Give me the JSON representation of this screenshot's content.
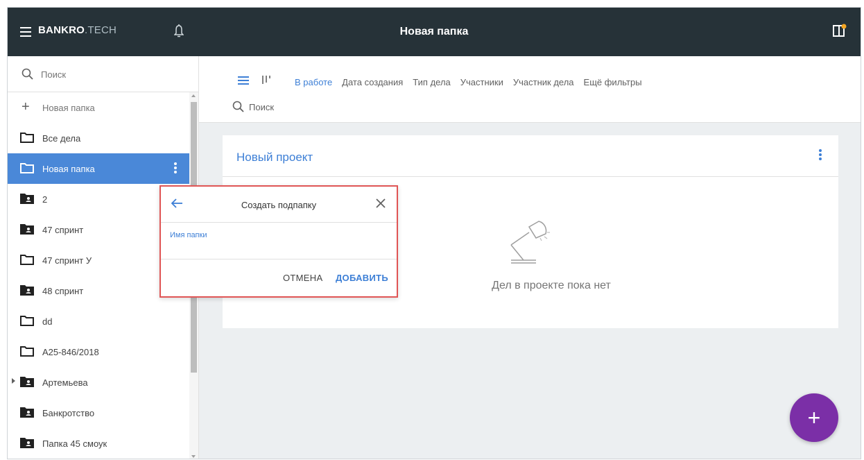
{
  "header": {
    "brand_main": "BANKRO",
    "brand_sub": ".TECH",
    "title": "Новая папка"
  },
  "sidebar": {
    "search_placeholder": "Поиск",
    "new_folder_label": "Новая папка",
    "items": [
      {
        "label": "Все дела",
        "icon": "folder-outline-icon"
      },
      {
        "label": "Новая папка",
        "icon": "folder-outline-icon",
        "active": true
      },
      {
        "label": "2",
        "icon": "shared-folder-icon"
      },
      {
        "label": "47 спринт",
        "icon": "shared-folder-icon"
      },
      {
        "label": "47 спринт У",
        "icon": "folder-outline-icon"
      },
      {
        "label": "48 спринт",
        "icon": "shared-folder-icon"
      },
      {
        "label": "dd",
        "icon": "folder-outline-icon"
      },
      {
        "label": "А25-846/2018",
        "icon": "folder-outline-icon"
      },
      {
        "label": "Артемьева",
        "icon": "shared-folder-icon",
        "expandable": true
      },
      {
        "label": "Банкротство",
        "icon": "shared-folder-icon"
      },
      {
        "label": "Папка 45 смоук",
        "icon": "shared-folder-icon"
      }
    ]
  },
  "filters": {
    "items": [
      "В работе",
      "Дата создания",
      "Тип дела",
      "Участники",
      "Участник дела",
      "Ещё фильтры"
    ],
    "active": "В работе",
    "search_placeholder": "Поиск"
  },
  "project": {
    "title": "Новый проект",
    "empty_text": "Дел в проекте пока нет"
  },
  "dialog": {
    "title": "Создать подпапку",
    "field_label": "Имя папки",
    "field_value": "",
    "cancel": "ОТМЕНА",
    "add": "ДОБАВИТЬ"
  },
  "fab": {
    "label": "+"
  },
  "colors": {
    "header_bg": "#263238",
    "accent": "#3d7fd6",
    "active_item": "#4a88d8",
    "fab": "#7b2fa7",
    "notification_dot": "#f5a623",
    "dialog_outline": "#e05555"
  }
}
